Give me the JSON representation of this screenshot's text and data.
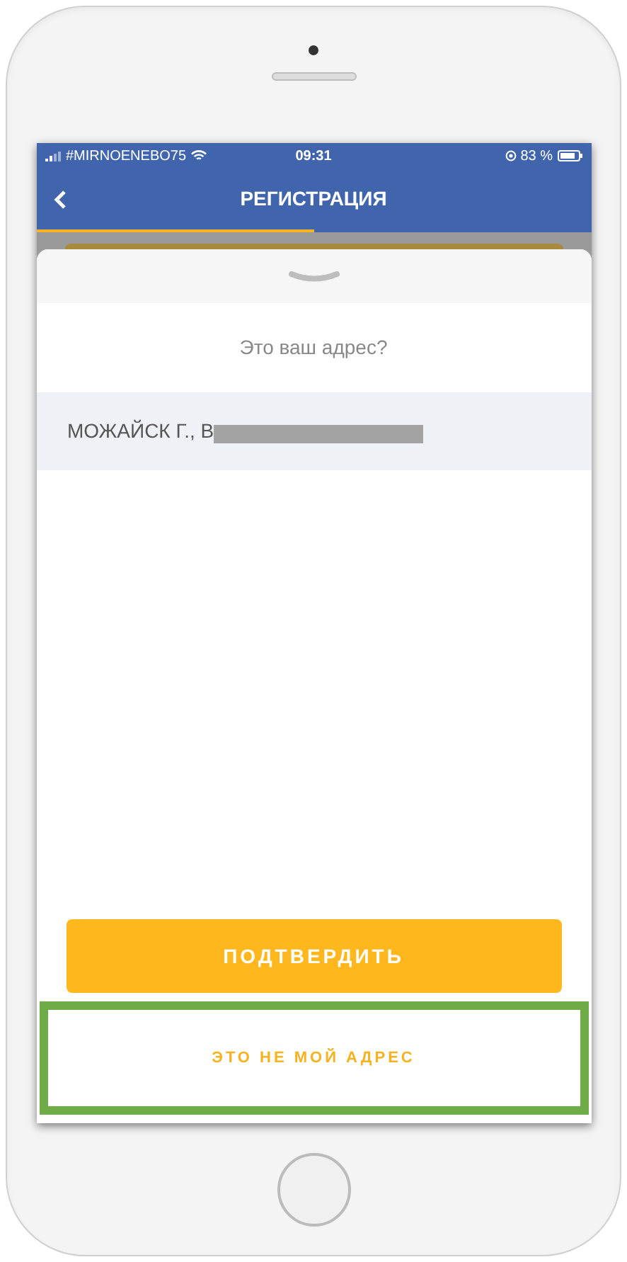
{
  "status_bar": {
    "carrier": "#MIRNOENEBO75",
    "time": "09:31",
    "battery": "83 %"
  },
  "nav": {
    "title": "РЕГИСТРАЦИЯ",
    "progress": {
      "level": 0.5
    }
  },
  "sheet": {
    "prompt": "Это ваш адрес?",
    "address": "МОЖАЙСК Г., В",
    "address_redacted": true
  },
  "buttons": [
    {
      "label": "ПОДТВЕРДИТЬ",
      "kind": "primary",
      "highlighted": false
    },
    {
      "label": "ЭТО НЕ МОЙ АДРЕС",
      "kind": "secondary",
      "highlighted": true
    }
  ]
}
